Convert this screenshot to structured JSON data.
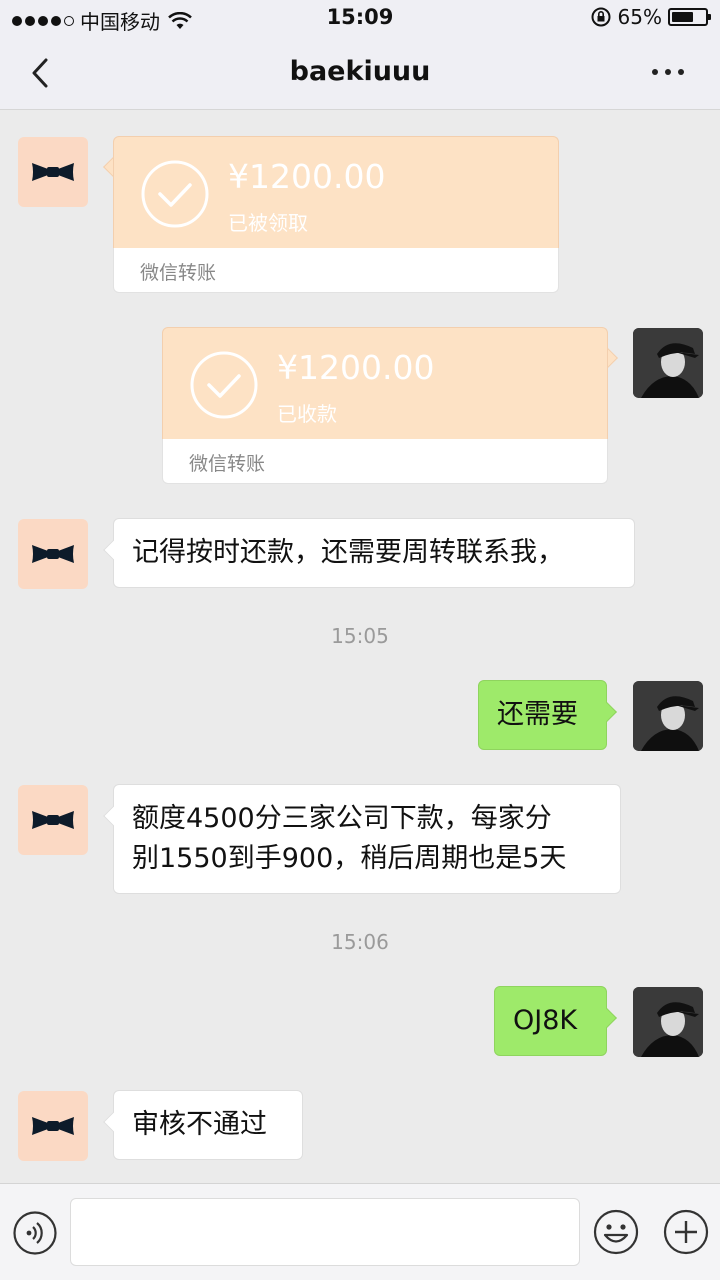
{
  "status_bar": {
    "carrier": "中国移动",
    "time": "15:09",
    "battery_percent": "65%",
    "battery_level": 0.65,
    "signal_bars": 4
  },
  "nav": {
    "title": "baekiuuu"
  },
  "messages": [
    {
      "type": "transfer",
      "side": "left",
      "amount": "¥1200.00",
      "status": "已被领取",
      "label": "微信转账"
    },
    {
      "type": "transfer",
      "side": "right",
      "amount": "¥1200.00",
      "status": "已收款",
      "label": "微信转账"
    },
    {
      "type": "text",
      "side": "left",
      "text": "记得按时还款，还需要周转联系我，"
    },
    {
      "type": "time",
      "text": "15:05"
    },
    {
      "type": "text",
      "side": "right",
      "text": "还需要"
    },
    {
      "type": "text",
      "side": "left",
      "text": "额度4500分三家公司下款，每家分\n别1550到手900，稍后周期也是5天"
    },
    {
      "type": "time",
      "text": "15:06"
    },
    {
      "type": "text",
      "side": "right",
      "text": "OJ8K"
    },
    {
      "type": "text",
      "side": "left",
      "text": "审核不通过"
    }
  ],
  "input_bar": {
    "value": "",
    "icons": [
      "voice-icon",
      "emoji-icon",
      "plus-icon"
    ]
  },
  "colors": {
    "transfer_card": "#fde2c5",
    "sent_bubble": "#9eea6a",
    "received_bubble": "#ffffff",
    "background": "#ebebeb"
  }
}
